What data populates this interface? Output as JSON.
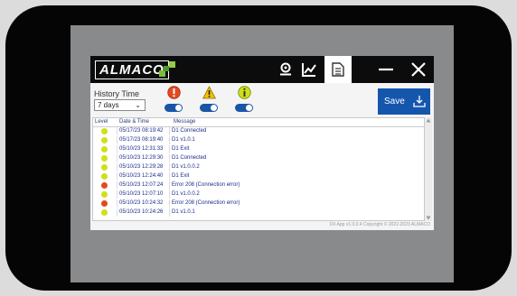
{
  "app": {
    "logo_text": "ALMACO",
    "footer": "DX App v1.0.0.4  Copyright © 2022-2023 ALMACO"
  },
  "titlebar": {
    "icons": [
      "sensor-icon",
      "chart-icon",
      "document-icon",
      "minimize-icon",
      "close-icon"
    ]
  },
  "toolbar": {
    "history_label": "History Time",
    "history_value": "7 days",
    "filters": [
      {
        "name": "error",
        "color": "#e24a1d",
        "enabled": true
      },
      {
        "name": "warning",
        "color": "#f2c200",
        "enabled": true
      },
      {
        "name": "info",
        "color": "#cfe01a",
        "enabled": true
      }
    ],
    "save_label": "Save"
  },
  "table": {
    "headers": [
      "Level",
      "Date & Time",
      "Message"
    ],
    "rows": [
      {
        "level": "info",
        "datetime": "05/17/23 08:19:42",
        "message": "D1 Connected"
      },
      {
        "level": "info",
        "datetime": "05/17/23 08:19:40",
        "message": "D1 v1.0.1"
      },
      {
        "level": "info",
        "datetime": "05/10/23 12:31:33",
        "message": "D1 Exit"
      },
      {
        "level": "info",
        "datetime": "05/10/23 12:29:30",
        "message": "D1 Connected"
      },
      {
        "level": "info",
        "datetime": "05/10/23 12:29:28",
        "message": "D1 v1.0.0.2"
      },
      {
        "level": "info",
        "datetime": "05/10/23 12:24:40",
        "message": "D1 Exit"
      },
      {
        "level": "error",
        "datetime": "05/10/23 12:07:24",
        "message": "Error 208 (Connection error)"
      },
      {
        "level": "info",
        "datetime": "05/10/23 12:07:10",
        "message": "D1 v1.0.0.2"
      },
      {
        "level": "error",
        "datetime": "05/10/23 10:24:32",
        "message": "Error 208 (Connection error)"
      },
      {
        "level": "info",
        "datetime": "05/10/23 10:24:26",
        "message": "D1 v1.0.1"
      }
    ],
    "level_colors": {
      "info": "#cfe01a",
      "error": "#e24a1d",
      "warning": "#f2c200"
    }
  }
}
